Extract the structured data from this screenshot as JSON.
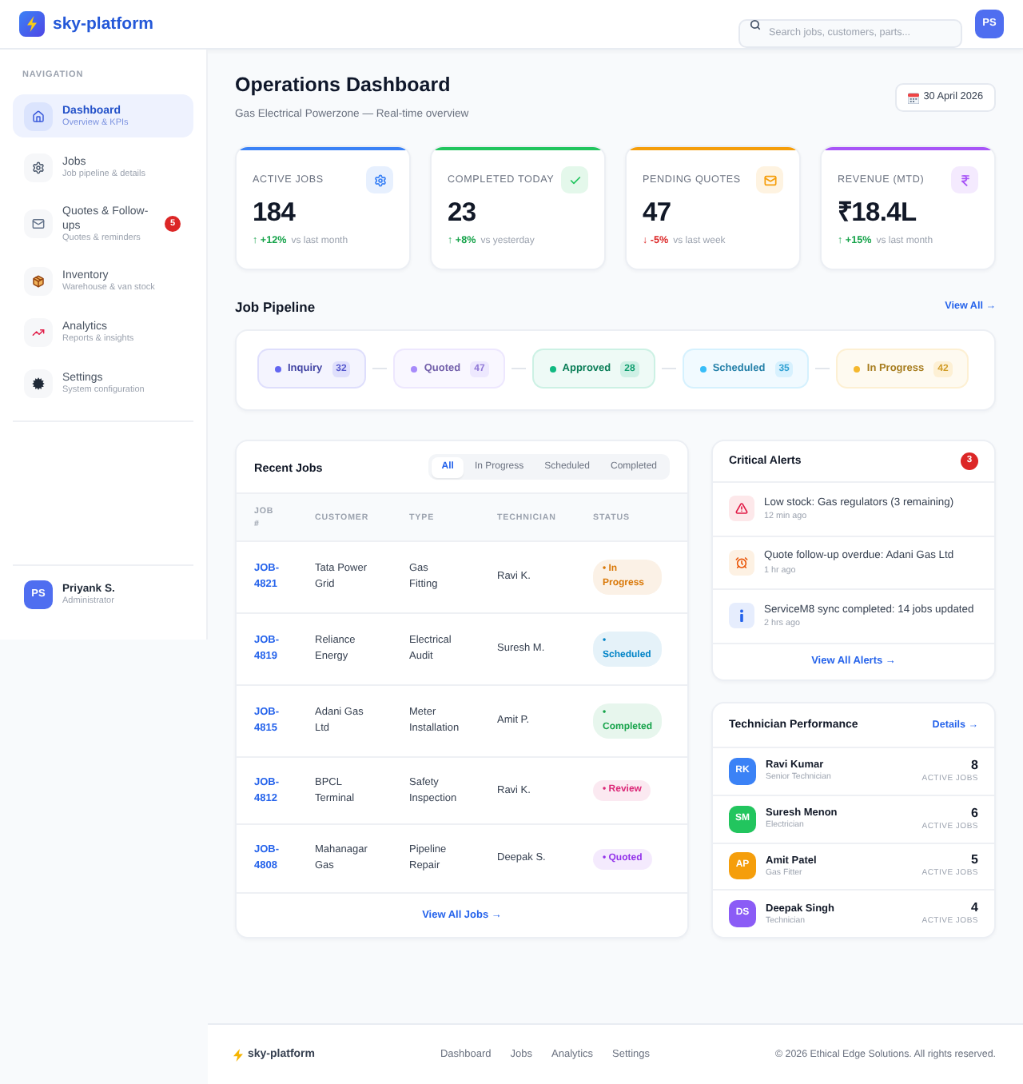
{
  "header": {
    "brand": "sky-platform",
    "search": {
      "placeholder": "Search jobs, customers, parts..."
    },
    "avatar": "PS"
  },
  "sidebar": {
    "heading": "NAVIGATION",
    "items": [
      {
        "label": "Dashboard",
        "caption": "Overview & KPIs",
        "selected": true
      },
      {
        "label": "Jobs",
        "caption": "Job pipeline & details",
        "selected": false
      },
      {
        "label": "Quotes & Follow-ups",
        "caption": "Quotes & reminders",
        "selected": false,
        "badge": "5"
      },
      {
        "label": "Inventory",
        "caption": "Warehouse & van stock",
        "selected": false
      },
      {
        "label": "Analytics",
        "caption": "Reports & insights",
        "selected": false
      },
      {
        "label": "Settings",
        "caption": "System configuration",
        "selected": false
      }
    ],
    "user": {
      "initials": "PS",
      "name": "Priyank S.",
      "role": "Administrator"
    }
  },
  "page": {
    "title": "Operations Dashboard",
    "subtitle": "Gas Electrical Powerzone — Real-time overview",
    "date": "30 April 2026"
  },
  "stats": [
    {
      "label": "ACTIVE JOBS",
      "value": "184",
      "change": "↑ +12%",
      "positive": true,
      "comparison": "vs last month",
      "color": "#3b82f6"
    },
    {
      "label": "COMPLETED TODAY",
      "value": "23",
      "change": "↑ +8%",
      "positive": true,
      "comparison": "vs yesterday",
      "color": "#22c55e"
    },
    {
      "label": "PENDING QUOTES",
      "value": "47",
      "change": "↓ -5%",
      "positive": false,
      "comparison": "vs last week",
      "color": "#f59e0b"
    },
    {
      "label": "REVENUE (MTD)",
      "value": "₹18.4L",
      "change": "↑ +15%",
      "positive": true,
      "comparison": "vs last month",
      "color": "#a855f7"
    }
  ],
  "pipeline": {
    "title": "Job Pipeline",
    "link": "View All →",
    "stages": [
      {
        "label": "Inquiry",
        "count": "32",
        "color": "#6366f1"
      },
      {
        "label": "Quoted",
        "count": "47",
        "color": "#a78bfa"
      },
      {
        "label": "Approved",
        "count": "28",
        "color": "#10b981"
      },
      {
        "label": "Scheduled",
        "count": "35",
        "color": "#38bdf8"
      },
      {
        "label": "In Progress",
        "count": "42",
        "color": "#f5b82e"
      }
    ]
  },
  "recent_jobs": {
    "title": "Recent Jobs",
    "tabs": [
      {
        "label": "All",
        "selected": true
      },
      {
        "label": "In Progress",
        "selected": false
      },
      {
        "label": "Scheduled",
        "selected": false
      },
      {
        "label": "Completed",
        "selected": false
      }
    ],
    "columns": [
      "JOB #",
      "CUSTOMER",
      "TYPE",
      "TECHNICIAN",
      "STATUS"
    ],
    "rows": [
      {
        "job": "JOB-4821",
        "customer": "Tata Power Grid",
        "type": "Gas Fitting",
        "technician": "Ravi K.",
        "status": {
          "label": "• In Progress",
          "color": "#d97706"
        }
      },
      {
        "job": "JOB-4819",
        "customer": "Reliance Energy",
        "type": "Electrical Audit",
        "technician": "Suresh M.",
        "status": {
          "label": "• Scheduled",
          "color": "#0284c7"
        }
      },
      {
        "job": "JOB-4815",
        "customer": "Adani Gas Ltd",
        "type": "Meter Installation",
        "technician": "Amit P.",
        "status": {
          "label": "• Completed",
          "color": "#16a34a"
        }
      },
      {
        "job": "JOB-4812",
        "customer": "BPCL Terminal",
        "type": "Safety Inspection",
        "technician": "Ravi K.",
        "status": {
          "label": "• Review",
          "color": "#db2777"
        }
      },
      {
        "job": "JOB-4808",
        "customer": "Mahanagar Gas",
        "type": "Pipeline Repair",
        "technician": "Deepak S.",
        "status": {
          "label": "• Quoted",
          "color": "#9333ea"
        }
      }
    ],
    "link": "View All Jobs →"
  },
  "alerts": {
    "title": "Critical Alerts",
    "count": "3",
    "items": [
      {
        "kind": "warning",
        "text": "Low stock: Gas regulators (3 remaining)",
        "time": "12 min ago"
      },
      {
        "kind": "reminder",
        "text": "Quote follow-up overdue: Adani Gas Ltd",
        "time": "1 hr ago"
      },
      {
        "kind": "info",
        "text": "ServiceM8 sync completed: 14 jobs updated",
        "time": "2 hrs ago"
      }
    ],
    "link": "View All Alerts →"
  },
  "technicians": {
    "title": "Technician Performance",
    "link": "Details →",
    "items": [
      {
        "initials": "RK",
        "name": "Ravi Kumar",
        "role": "Senior Technician",
        "count": "8",
        "count_label": "ACTIVE JOBS",
        "color": "#3b82f6"
      },
      {
        "initials": "SM",
        "name": "Suresh Menon",
        "role": "Electrician",
        "count": "6",
        "count_label": "ACTIVE JOBS",
        "color": "#22c55e"
      },
      {
        "initials": "AP",
        "name": "Amit Patel",
        "role": "Gas Fitter",
        "count": "5",
        "count_label": "ACTIVE JOBS",
        "color": "#f59e0b"
      },
      {
        "initials": "DS",
        "name": "Deepak Singh",
        "role": "Technician",
        "count": "4",
        "count_label": "ACTIVE JOBS",
        "color": "#8b5cf6"
      }
    ]
  },
  "footer": {
    "brand": "sky-platform",
    "links": [
      "Dashboard",
      "Jobs",
      "Analytics",
      "Settings"
    ],
    "copyright": "© 2026 Ethical Edge Solutions. All rights reserved."
  }
}
